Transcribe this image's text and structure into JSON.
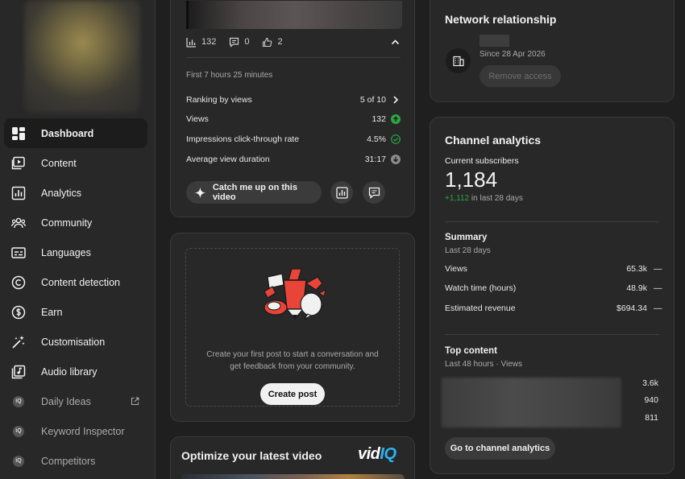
{
  "sidebar": {
    "items": [
      {
        "label": "Dashboard",
        "icon": "dashboard-icon",
        "active": true
      },
      {
        "label": "Content",
        "icon": "content-icon"
      },
      {
        "label": "Analytics",
        "icon": "analytics-icon"
      },
      {
        "label": "Community",
        "icon": "community-icon"
      },
      {
        "label": "Languages",
        "icon": "subtitles-icon"
      },
      {
        "label": "Content detection",
        "icon": "copyright-icon"
      },
      {
        "label": "Earn",
        "icon": "dollar-icon"
      },
      {
        "label": "Customisation",
        "icon": "magic-wand-icon"
      },
      {
        "label": "Audio library",
        "icon": "audio-library-icon"
      },
      {
        "label": "Daily Ideas",
        "icon": "vidiq-icon",
        "external": true
      },
      {
        "label": "Keyword Inspector",
        "icon": "vidiq-icon"
      },
      {
        "label": "Competitors",
        "icon": "vidiq-icon"
      }
    ]
  },
  "video_card": {
    "stats": {
      "views": "132",
      "comments": "0",
      "likes": "2"
    },
    "period": "First 7 hours 25 minutes",
    "metrics": [
      {
        "label": "Ranking by views",
        "value": "5 of 10",
        "indicator": "chevron-right"
      },
      {
        "label": "Views",
        "value": "132",
        "indicator": "up-green"
      },
      {
        "label": "Impressions click-through rate",
        "value": "4.5%",
        "indicator": "check-green"
      },
      {
        "label": "Average view duration",
        "value": "31:17",
        "indicator": "down-grey"
      }
    ],
    "catch_up_label": "Catch me up on this video"
  },
  "post_card": {
    "line1": "Create your first post to start a conversation and",
    "line2": "get feedback from your community.",
    "button": "Create post"
  },
  "optimize_card": {
    "title": "Optimize your latest video",
    "brand_vid": "vid",
    "brand_iq": "IQ"
  },
  "network_card": {
    "title": "Network relationship",
    "since": "Since 28 Apr 2026",
    "button": "Remove access"
  },
  "analytics_card": {
    "title": "Channel analytics",
    "subs_label": "Current subscribers",
    "subs_value": "1,184",
    "subs_delta": "+1,112",
    "subs_delta_period": "in last 28 days",
    "summary_title": "Summary",
    "summary_period": "Last 28 days",
    "summary": [
      {
        "label": "Views",
        "value": "65.3k",
        "trend": "—"
      },
      {
        "label": "Watch time (hours)",
        "value": "48.9k",
        "trend": "—"
      },
      {
        "label": "Estimated revenue",
        "value": "$694.34",
        "trend": "—"
      }
    ],
    "top_title": "Top content",
    "top_period": "Last 48 hours · Views",
    "top_values": [
      "3.6k",
      "940",
      "811"
    ],
    "button": "Go to channel analytics"
  },
  "colors": {
    "accent_green": "#2ba640",
    "vidiq_blue": "#29b6f6",
    "post_red": "#e84438"
  }
}
